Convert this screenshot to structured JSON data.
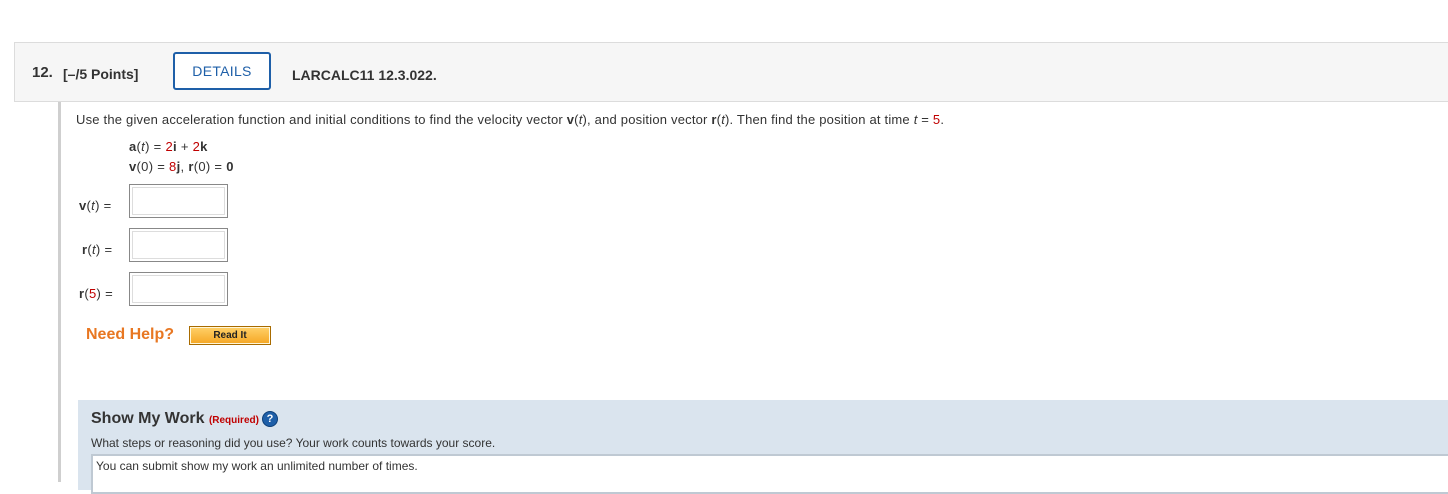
{
  "question": {
    "number": "12.",
    "points": "[–/5 Points]",
    "details_label": "DETAILS",
    "code": "LARCALC11 12.3.022."
  },
  "prompt": {
    "part1": "Use the given acceleration function and initial conditions to find the velocity vector ",
    "v": "v",
    "part2": "(",
    "t1": "t",
    "part3": "), and position vector ",
    "r": "r",
    "part4": "(",
    "t2": "t",
    "part5": "). Then find the position at time ",
    "t3": "t",
    "part6": " = ",
    "time_value": "5",
    "part7": "."
  },
  "given": {
    "line1": {
      "a": "a",
      "open": "(",
      "t": "t",
      "close": ") = ",
      "c1": "2",
      "i": "i",
      "plus": " + ",
      "c2": "2",
      "k": "k"
    },
    "line2": {
      "v": "v",
      "v0": "(0) = ",
      "c": "8",
      "j": "j",
      "sep": ", ",
      "r": "r",
      "r0": "(0) = ",
      "zero": "0"
    }
  },
  "answers": [
    {
      "label_bold": "v",
      "label_open": "(",
      "label_var": "t",
      "label_close": ")",
      "label_num": "",
      "eq": " = ",
      "value": ""
    },
    {
      "label_bold": "r",
      "label_open": "(",
      "label_var": "t",
      "label_close": ")",
      "label_num": "",
      "eq": " = ",
      "value": ""
    },
    {
      "label_bold": "r",
      "label_open": "(",
      "label_var": "",
      "label_close": ")",
      "label_num": "5",
      "eq": " = ",
      "value": ""
    }
  ],
  "help": {
    "need_help": "Need Help?",
    "read_it": "Read It"
  },
  "show_my_work": {
    "title": "Show My Work ",
    "required": "(Required)",
    "help_glyph": "?",
    "description": "What steps or reasoning did you use? Your work counts towards your score.",
    "notice": "You can submit show my work an unlimited number of times."
  },
  "colors": {
    "accent": "#1e5fa8",
    "value_red": "#c00000",
    "help_orange": "#e87722",
    "work_bg": "#dae4ee"
  }
}
